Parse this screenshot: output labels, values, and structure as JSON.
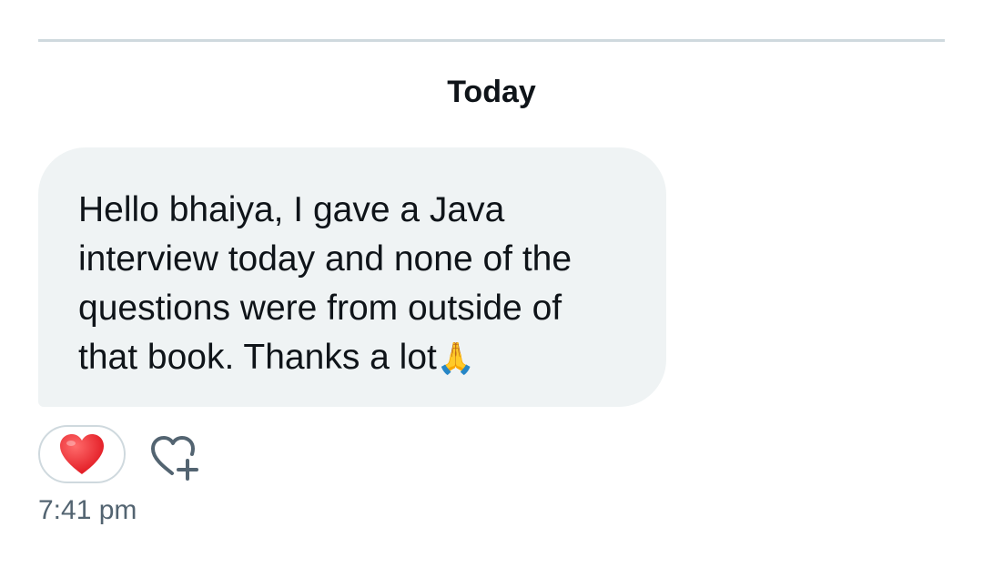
{
  "conversation": {
    "date_separator": "Today",
    "message": {
      "text": "Hello bhaiya, I gave a  Java\ninterview today and none of the\nquestions were from outside of\nthat book. Thanks a lot",
      "emoji": "🙏",
      "emoji_icon": "folded-hands-icon",
      "reaction": {
        "emoji": "❤️",
        "icon": "red-heart-icon"
      },
      "add_reaction_icon": "heart-plus-icon",
      "timestamp": "7:41 pm"
    }
  },
  "colors": {
    "bubble_bg": "#eff3f4",
    "text": "#0f1419",
    "muted": "#536471",
    "divider": "#cfd9de",
    "heart": "#f4212e"
  }
}
